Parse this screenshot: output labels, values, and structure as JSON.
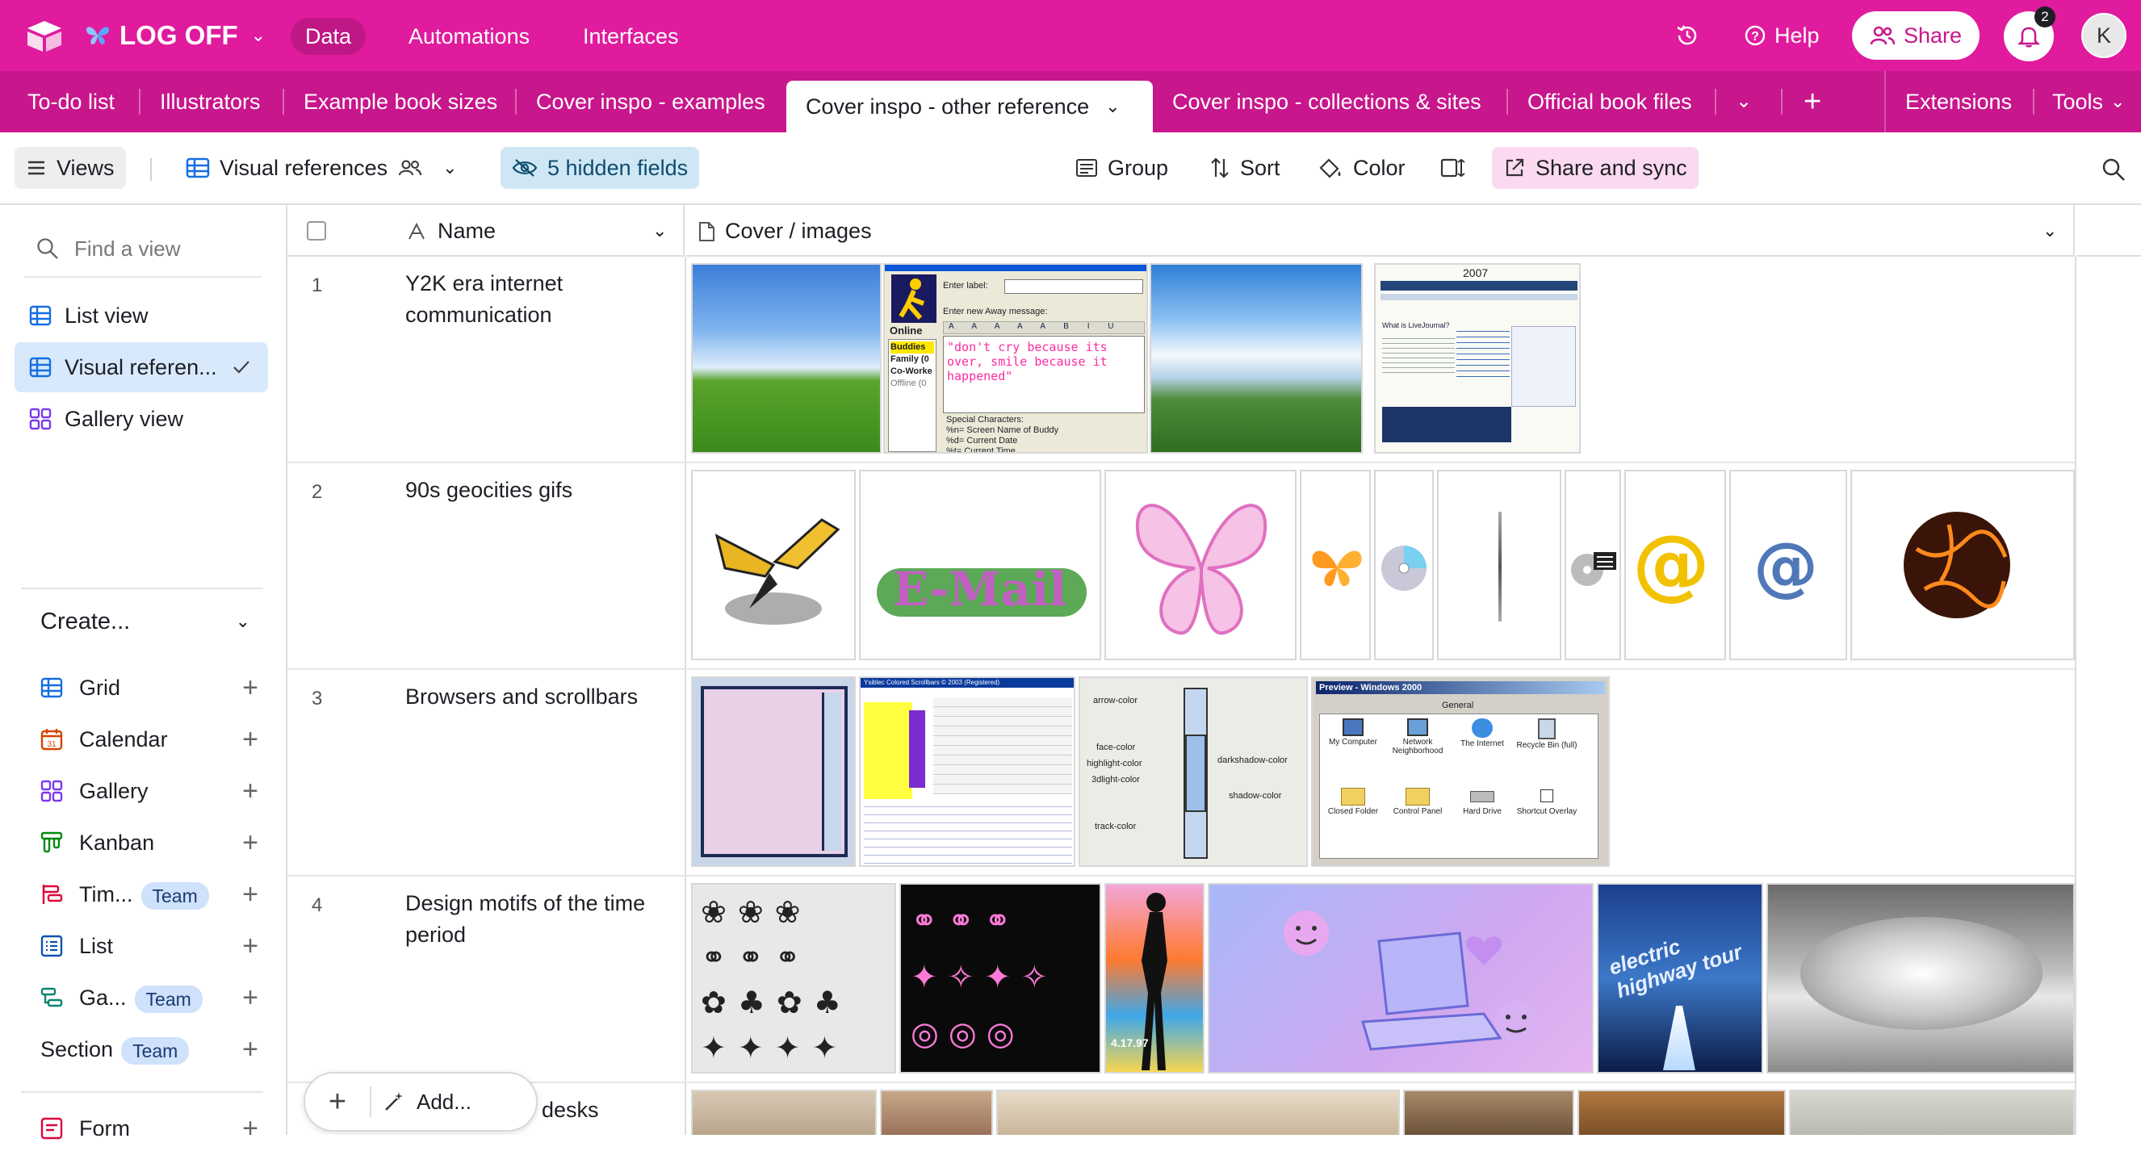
{
  "topbar": {
    "base_name": "LOG OFF",
    "nav": [
      "Data",
      "Automations",
      "Interfaces"
    ],
    "help_label": "Help",
    "share_label": "Share",
    "notification_count": "2",
    "avatar_initial": "K"
  },
  "tables": {
    "items": [
      "To-do list",
      "Illustrators",
      "Example book sizes",
      "Cover inspo - examples",
      "Cover inspo - other reference",
      "Cover inspo - collections & sites",
      "Official book files"
    ],
    "active_index": 4,
    "extensions_label": "Extensions",
    "tools_label": "Tools"
  },
  "toolbar": {
    "views_label": "Views",
    "current_view": "Visual references",
    "hidden_fields": "5 hidden fields",
    "group_label": "Group",
    "sort_label": "Sort",
    "color_label": "Color",
    "share_sync_label": "Share and sync"
  },
  "sidebar": {
    "search_placeholder": "Find a view",
    "views": [
      {
        "label": "List view",
        "icon": "grid-icon"
      },
      {
        "label": "Visual referen...",
        "icon": "grid-icon"
      },
      {
        "label": "Gallery view",
        "icon": "gallery-icon"
      }
    ],
    "create_label": "Create...",
    "create_items": [
      {
        "label": "Grid",
        "icon": "grid-icon",
        "color": "#166ee1"
      },
      {
        "label": "Calendar",
        "icon": "calendar-icon",
        "color": "#d54401"
      },
      {
        "label": "Gallery",
        "icon": "gallery-icon",
        "color": "#7c39ed"
      },
      {
        "label": "Kanban",
        "icon": "kanban-icon",
        "color": "#048a0e"
      },
      {
        "label": "Tim...",
        "icon": "timeline-icon",
        "color": "#dc043b",
        "badge": "Team"
      },
      {
        "label": "List",
        "icon": "list-icon",
        "color": "#0d52ac"
      },
      {
        "label": "Ga...",
        "icon": "gantt-icon",
        "color": "#0f8473",
        "badge": "Team"
      },
      {
        "label": "Section",
        "icon": "",
        "color": "",
        "badge": "Team"
      },
      {
        "label": "Form",
        "icon": "form-icon",
        "color": "#dc043b"
      }
    ]
  },
  "grid": {
    "columns": [
      "Name",
      "Cover / images"
    ],
    "rows": [
      {
        "num": "1",
        "name": "Y2K era internet communication"
      },
      {
        "num": "2",
        "name": "90s geocities gifs"
      },
      {
        "num": "3",
        "name": "Browsers and scrollbars"
      },
      {
        "num": "4",
        "name": "Design motifs of the time period"
      },
      {
        "num": "",
        "name": "ter desks"
      }
    ],
    "add_label": "Add...",
    "aim": {
      "online": "Online",
      "buddies": "Buddies",
      "family": "Family (0",
      "coworkers": "Co-Worke",
      "offline": "Offline (0",
      "enter_label": "Enter label:",
      "enter_away": "Enter new Away message:",
      "message": "\"don't cry because its over, smile because it happened\"",
      "special": "Special Characters:",
      "screen_name": "%n= Screen Name of Buddy",
      "date": "%d= Current Date",
      "time": "%t= Current Time"
    },
    "livejournal": {
      "year": "2007",
      "what_is": "What is LiveJournal?"
    },
    "scrollbar": {
      "arrow": "arrow-color",
      "face": "face-color",
      "highlight": "highlight-color",
      "d3light": "3dlight-color",
      "track": "track-color",
      "darkshadow": "darkshadow-color",
      "shadow": "shadow-color"
    },
    "win2000": {
      "title": "Preview - Windows 2000",
      "general": "General",
      "icons": [
        "My Computer",
        "Network Neighborhood",
        "The Internet",
        "Recycle Bin (full)",
        "Closed Folder",
        "Control Panel",
        "Hard Drive",
        "Shortcut Overlay"
      ]
    },
    "scroll_gen_title": "Ysiblec Colored Scrollbars © 2003 (Registered)",
    "poster_text": "4.17.97",
    "highway_text": "electric highway tour"
  }
}
